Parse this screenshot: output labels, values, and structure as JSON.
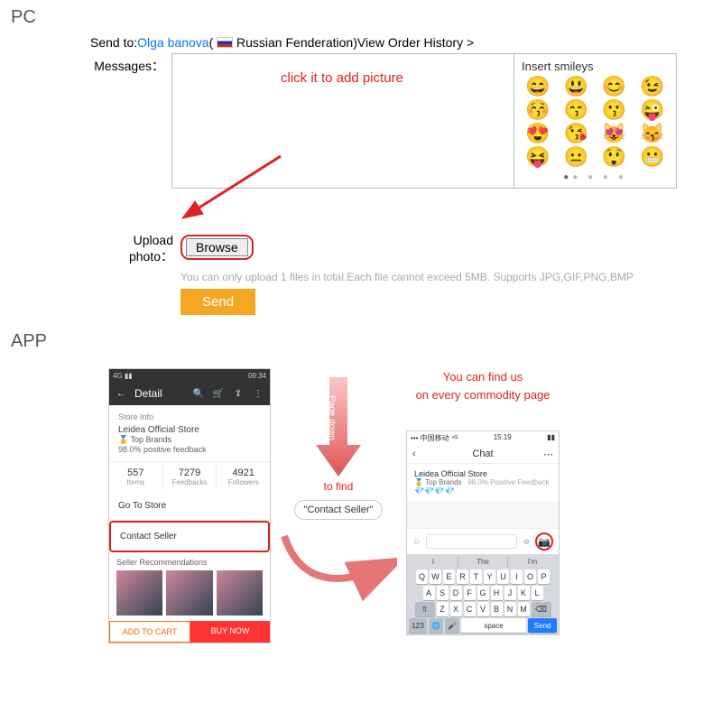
{
  "sections": {
    "pc": "PC",
    "app": "APP"
  },
  "pc": {
    "send_to_label": "Send to:",
    "recipient_name": "Olga banova",
    "country": "Russian Fenderation",
    "view_history": "View Order History >",
    "messages_label": "Messages：",
    "smileys_title": "Insert smileys",
    "emojis": [
      "😄",
      "😃",
      "😊",
      "😉",
      "😚",
      "😙",
      "😗",
      "😜",
      "😍",
      "😘",
      "😻",
      "😽",
      "😝",
      "😐",
      "😲",
      "😬"
    ],
    "annotation": "click it to add picture",
    "upload_label": "Upload photo：",
    "browse": "Browse",
    "upload_note": "You can only upload 1 files in total.Each file cannot exceed 5MB. Supports JPG,GIF,PNG,BMP",
    "send": "Send"
  },
  "app": {
    "phone1": {
      "status_time": "09:34",
      "header_title": "Detail",
      "store_info_label": "Store Info",
      "store_name": "Leidea Official Store",
      "top_brands": "Top Brands",
      "feedback": "98.0% positive feedback",
      "stats": [
        {
          "num": "557",
          "lbl": "Items"
        },
        {
          "num": "7279",
          "lbl": "Feedbacks"
        },
        {
          "num": "4921",
          "lbl": "Followers"
        }
      ],
      "go_to_store": "Go To Store",
      "contact_seller": "Contact Seller",
      "seller_recs": "Seller Recommendations",
      "add_to_cart": "ADD TO CART",
      "buy_now": "BUY NOW"
    },
    "mid": {
      "page_down": "Page down",
      "to_find": "to find",
      "contact_label": "\"Contact Seller\""
    },
    "find_us_line1": "You can find us",
    "find_us_line2": "on every commodity page",
    "phone2": {
      "carrier": "中国移动",
      "time": "15:19",
      "chat_title": "Chat",
      "store_name": "Leidea Official Store",
      "top_brands": "Top Brands",
      "feedback": "98.0% Positive Feedback",
      "suggestions": [
        "I",
        "The",
        "I'm"
      ],
      "row1": [
        "Q",
        "W",
        "E",
        "R",
        "T",
        "Y",
        "U",
        "I",
        "O",
        "P"
      ],
      "row2": [
        "A",
        "S",
        "D",
        "F",
        "G",
        "H",
        "J",
        "K",
        "L"
      ],
      "row3": [
        "Z",
        "X",
        "C",
        "V",
        "B",
        "N",
        "M"
      ],
      "num_key": "123",
      "space": "space",
      "send": "Send"
    }
  }
}
